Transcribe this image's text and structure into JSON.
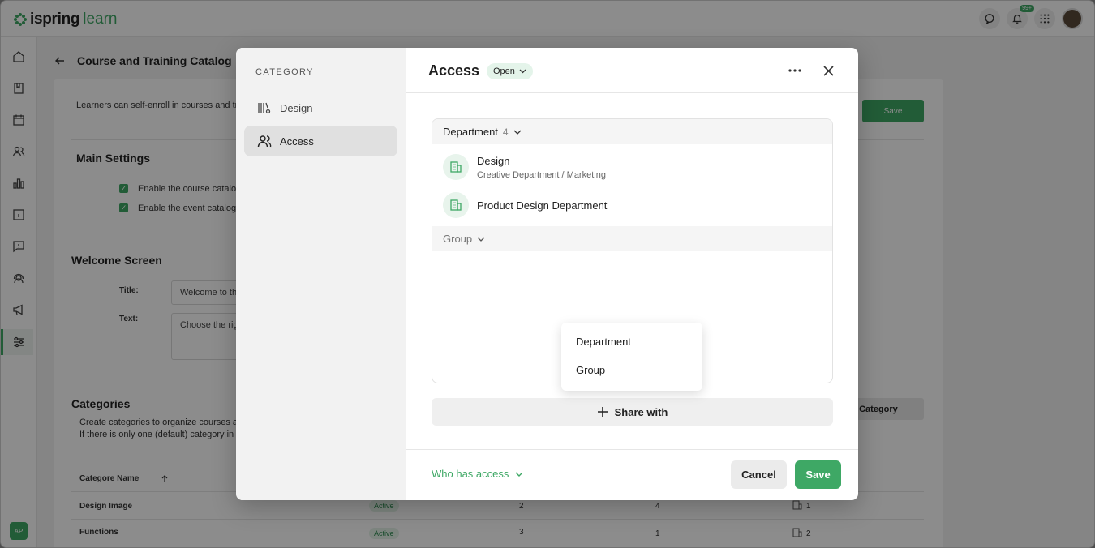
{
  "brand": {
    "name_part1": "ispring",
    "name_part2": "learn",
    "accent": "#3ea865"
  },
  "topbar": {
    "notification_badge": "99+",
    "icons": [
      "chat-icon",
      "bell-icon",
      "apps-grid-icon",
      "user-avatar"
    ]
  },
  "leftnav": {
    "items": [
      "home-icon",
      "book-icon",
      "calendar-icon",
      "users-icon",
      "chart-icon",
      "info-card-icon",
      "feedback-icon",
      "support-icon",
      "megaphone-icon",
      "settings-sliders-icon"
    ],
    "active": "settings-sliders-icon",
    "user_initials": "AP"
  },
  "page": {
    "title": "Course and Training Catalog",
    "intro": "Learners can self-enroll in courses and tr",
    "save_label": "Save",
    "main_settings": {
      "heading": "Main Settings",
      "option1": "Enable the course catalog",
      "option2": "Enable the event catalog"
    },
    "welcome": {
      "heading": "Welcome Screen",
      "title_label": "Title:",
      "title_value": "Welcome to th",
      "text_label": "Text:",
      "text_value": "Choose the rig"
    },
    "categories": {
      "heading": "Categories",
      "desc1": "Create categories to organize courses a",
      "desc2": "If there is only one (default) category in",
      "add_label": "l Category",
      "column_name": "Categore Name",
      "rows": [
        {
          "name": "Design Image",
          "status": "Active",
          "c1": "2",
          "c2": "4",
          "c3": "1"
        },
        {
          "name": "Functions",
          "status": "Active",
          "c1": "3",
          "c2": "1",
          "c3": "2"
        }
      ]
    }
  },
  "modal": {
    "side_title": "CATEGORY",
    "side_items": [
      {
        "label": "Design",
        "icon": "design-settings-icon",
        "active": false
      },
      {
        "label": "Access",
        "icon": "users-icon",
        "active": true
      }
    ],
    "title": "Access",
    "status": "Open",
    "groups": {
      "department": {
        "label": "Department",
        "count": "4"
      },
      "group": {
        "label": "Group"
      }
    },
    "entries": [
      {
        "name": "Design",
        "path": "Creative Department / Marketing"
      },
      {
        "name": "Product Design Department",
        "path": ""
      }
    ],
    "dropdown": [
      "Department",
      "Group"
    ],
    "share_label": "Share with",
    "footer": {
      "who_label": "Who has access",
      "cancel_label": "Cancel",
      "save_label": "Save"
    }
  }
}
